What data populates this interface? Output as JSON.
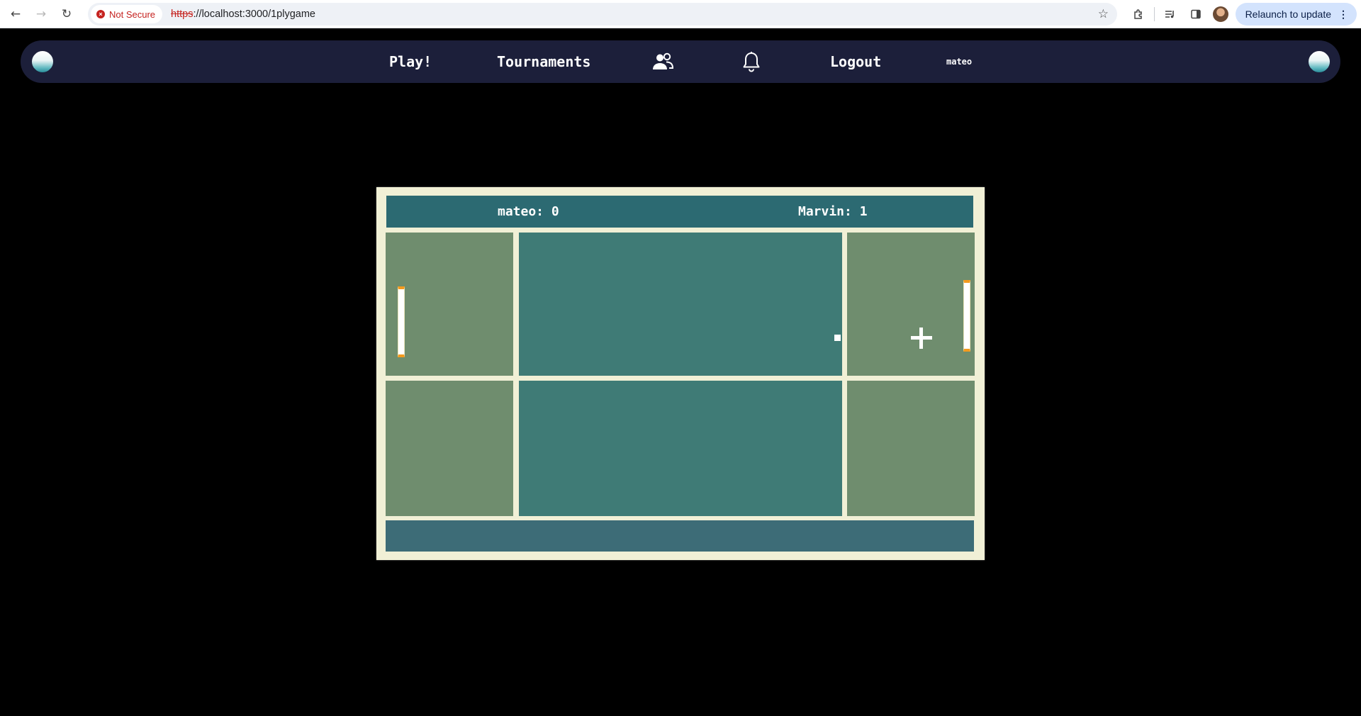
{
  "browser": {
    "security_label": "Not Secure",
    "url_scheme": "https",
    "url_rest": "://localhost:3000/1plygame",
    "relaunch_label": "Relaunch to update",
    "icons": [
      "back-arrow-icon",
      "forward-arrow-icon",
      "reload-icon",
      "star-icon",
      "extensions-icon",
      "media-icon",
      "side-panel-icon",
      "profile-avatar",
      "more-icon"
    ]
  },
  "nav": {
    "play": "Play!",
    "tournaments": "Tournaments",
    "friends_icon": "users-icon",
    "notifications_icon": "bell-icon",
    "logout": "Logout",
    "username": "mateo"
  },
  "game": {
    "player_left": "mateo: 0",
    "player_right": "Marvin: 1",
    "colors": {
      "frame": "#f1f0d6",
      "scorebar": "#2c6a72",
      "side_zone": "#6f8d6e",
      "mid_zone": "#3f7b76",
      "bottombar": "#3d6c77",
      "paddle_tip": "#f39a1e"
    }
  }
}
